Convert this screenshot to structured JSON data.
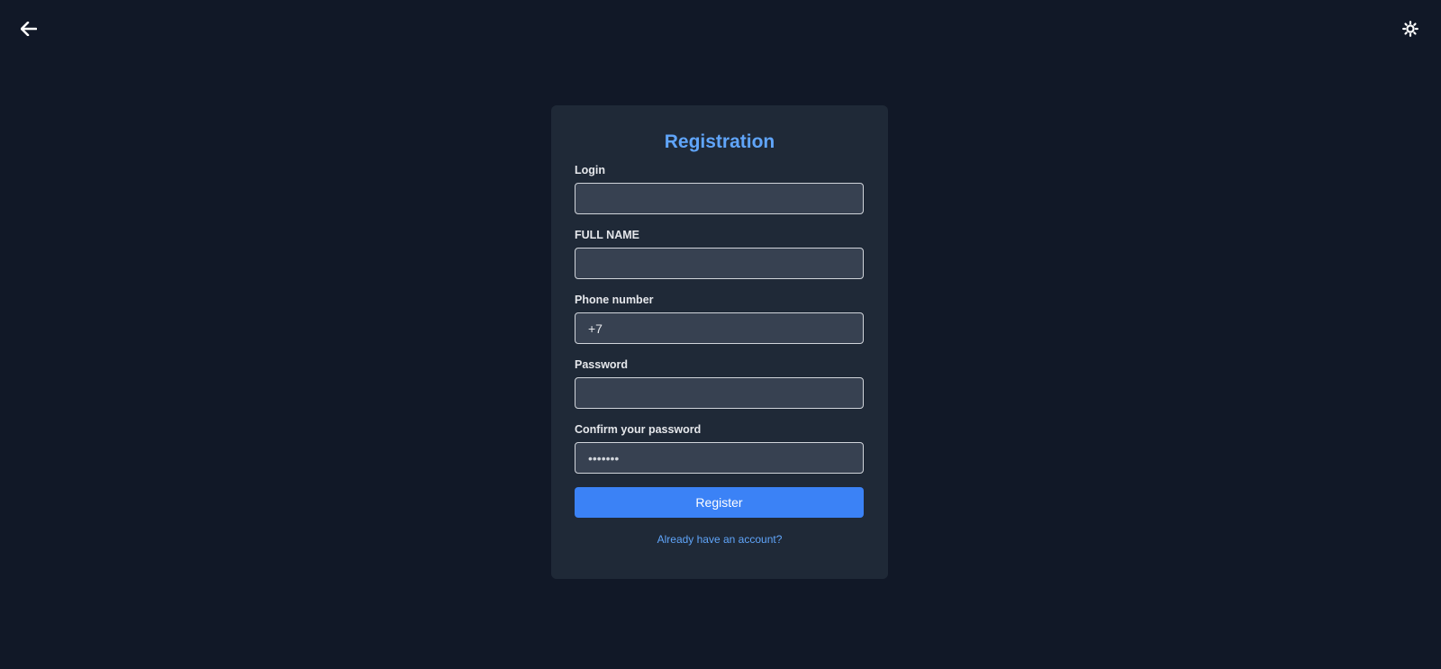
{
  "header": {
    "back_icon": "arrow-left-icon",
    "theme_icon": "sun-icon"
  },
  "form": {
    "title": "Registration",
    "fields": [
      {
        "label": "Login",
        "value": "",
        "placeholder": ""
      },
      {
        "label": "FULL NAME",
        "value": "",
        "placeholder": ""
      },
      {
        "label": "Phone number",
        "value": "+7",
        "placeholder": ""
      },
      {
        "label": "Password",
        "value": "",
        "placeholder": ""
      },
      {
        "label": "Confirm your password",
        "value": "",
        "placeholder": "•••••••"
      }
    ],
    "submit_label": "Register",
    "login_link": "Already have an account?"
  },
  "colors": {
    "background": "#111827",
    "card": "#1f2937",
    "input": "#374151",
    "accent": "#3b82f6",
    "title": "#60a5fa"
  }
}
